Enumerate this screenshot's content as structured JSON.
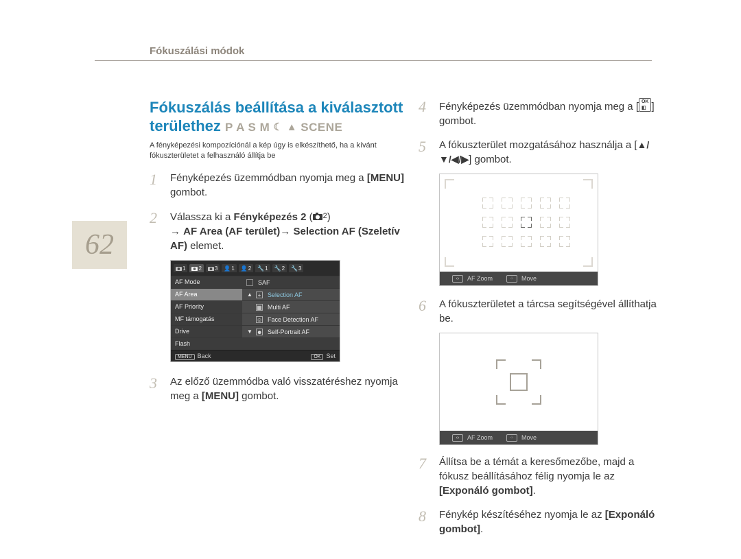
{
  "header": {
    "breadcrumb": "Fókuszálási módok"
  },
  "page_number": "62",
  "title": {
    "line1": "Fókuszálás beállítása a kiválasztott",
    "line2_word": "területhez",
    "modes": "P A S M",
    "modes_trailing": "SCENE"
  },
  "intro": "A fényképezési kompozíciónál a kép úgy is elkészíthető, ha a kívánt fókuszterületet a felhasználó állítja be",
  "steps": {
    "1": {
      "text_a": "Fényképezés üzemmódban nyomja meg a ",
      "bold": "[MENU]",
      "text_b": " gombot."
    },
    "2": {
      "pre": "Válassza ki a ",
      "bold1": "Fényképezés 2",
      "icon_sub": "2",
      "line2a": "→ ",
      "bold2": "AF Area (AF terület)",
      "line2b": "→ ",
      "bold3": "Selection AF (Szeletív AF)",
      "post": " elemet."
    },
    "3": {
      "text_a": "Az előző üzemmódba való visszatéréshez nyomja meg a ",
      "bold": "[MENU]",
      "text_b": " gombot."
    },
    "4": {
      "text_a": "Fényképezés üzemmódban nyomja meg a [",
      "ok_top": "OK",
      "ok_bot": "◧",
      "text_b": "] gombot."
    },
    "5": {
      "text_a": "A fókuszterület mozgatásához használja a [",
      "keys": "▲/▼/◀/▶",
      "text_b": "] gombot."
    },
    "6": {
      "text": "A fókuszterületet a tárcsa segítségével állíthatja be."
    },
    "7": {
      "text_a": "Állítsa be a témát a keresőmezőbe, majd a fókusz beállításához félig nyomja le az ",
      "bold": "[Exponáló gombot]",
      "text_b": "."
    },
    "8": {
      "text_a": "Fénykép készítéséhez nyomja le az ",
      "bold": "[Exponáló gombot]",
      "text_b": "."
    }
  },
  "menu": {
    "tabs": {
      "cam1": "1",
      "cam2": "2",
      "cam3": "3",
      "user1": "1",
      "user2": "2",
      "gear1": "1",
      "gear2": "2",
      "gear3": "3"
    },
    "rows": {
      "af_mode": {
        "label": "AF Mode",
        "value": "SAF"
      },
      "af_area": {
        "label": "AF Area",
        "value": "Selection AF",
        "icon": "+"
      },
      "af_priority": {
        "label": "AF Priority",
        "value": "Multi AF",
        "icon": "▦"
      },
      "mf": {
        "label": "MF támogatás",
        "value": "Face Detection AF",
        "icon": "☺"
      },
      "drive": {
        "label": "Drive",
        "value": "Self-Portrait AF",
        "icon": "☻"
      },
      "flash": {
        "label": "Flash",
        "value": ""
      }
    },
    "footer": {
      "back_btn": "MENU",
      "back": "Back",
      "set_btn": "OK",
      "set": "Set"
    }
  },
  "preview_footer": {
    "zoom": "AF Zoom",
    "move": "Move"
  }
}
